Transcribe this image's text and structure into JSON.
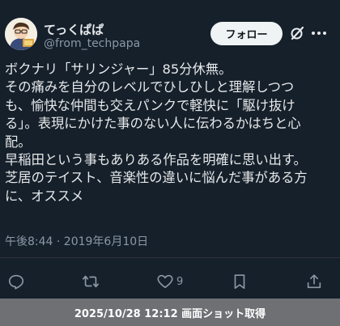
{
  "user": {
    "display_name": "てっくぱぱ",
    "handle": "@from_techpapa",
    "avatar_icon": "illustrated-person-avatar"
  },
  "header": {
    "follow_label": "フォロー",
    "grok_icon": "grok-slash-icon",
    "more_icon": "more-dots-icon"
  },
  "tweet": {
    "lines": [
      "ボクナリ「サリンジャー」85分休無。",
      "その痛みを自分のレベルでひしひしと理解しつつ",
      "も、愉快な仲間も交えパンクで軽快に「駆け抜け",
      "る」。表現にかけた事のない人に伝わるかはちと心",
      "配。",
      "早稲田という事もありある作品を明確に思い出す。",
      "芝居のテイスト、音楽性の違いに悩んだ事がある方",
      "に、オススメ"
    ],
    "timestamp": "午後8:44 · 2019年6月10日"
  },
  "actions": {
    "reply_icon": "reply-icon",
    "retweet_icon": "retweet-icon",
    "like_icon": "heart-icon",
    "like_count": "9",
    "bookmark_icon": "bookmark-icon",
    "share_icon": "share-icon"
  },
  "footer": {
    "capture_text": "2025/10/28 12:12 画面ショット取得"
  },
  "colors": {
    "background": "#15202b",
    "text_primary": "#e7e9ea",
    "text_secondary": "#8b98a5",
    "follow_button_bg": "#eff3f4",
    "footer_bg": "#6f7074"
  }
}
